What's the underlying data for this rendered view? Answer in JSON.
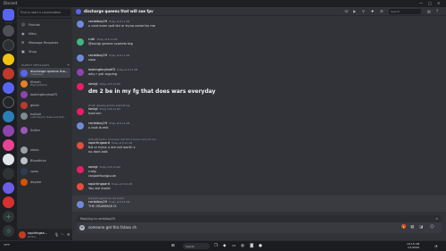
{
  "window": {
    "title": "Discord",
    "controls": [
      "—",
      "□",
      "✕"
    ]
  },
  "colors": {
    "accent": "#5865f2",
    "bg": "#313338",
    "sidebar": "#2b2d31",
    "rail": "#1e1f22"
  },
  "sidebar": {
    "search_placeholder": "Find or start a conversation",
    "nav": [
      {
        "icon": "friends-icon",
        "glyph": "☺",
        "label": "Friends"
      },
      {
        "icon": "nitro-icon",
        "glyph": "◉",
        "label": "Nitro"
      },
      {
        "icon": "message-requests-icon",
        "glyph": "✉",
        "label": "Message Requests"
      },
      {
        "icon": "shop-icon",
        "glyph": "▣",
        "label": "Shop"
      }
    ],
    "dm_header": "DIRECT MESSAGES",
    "dm_add": "+",
    "dms": [
      {
        "name": "discharge queens tha...",
        "sub": "5 Members",
        "color": "#5865f2",
        "active": true
      },
      {
        "name": "Ktrash",
        "sub": "Playing Roblox",
        "color": "#e67e22"
      },
      {
        "name": "lookingforyksdf3",
        "sub": "",
        "color": "#8e44ad"
      },
      {
        "name": "glotzi",
        "sub": "",
        "color": "#c0392b"
      },
      {
        "name": "hailroll",
        "sub": "I just have to make sure that...",
        "color": "#7f8c8d"
      },
      {
        "name": "Sullen",
        "sub": "",
        "color": "#9b59b6"
      },
      {
        "name": "vibes",
        "sub": "",
        "color": "#95a5a6"
      },
      {
        "name": "Bloodhive",
        "sub": "",
        "color": "#bdc3c7"
      },
      {
        "name": "cows",
        "sub": "",
        "color": "#2c3e50"
      },
      {
        "name": "deyste",
        "sub": "",
        "color": "#d35400"
      }
    ],
    "user": {
      "name": "squirtingaa...",
      "status": "Online"
    }
  },
  "header": {
    "title": "discharge queens that will sue fpv",
    "search_placeholder": "Search"
  },
  "messages": [
    {
      "author": "racistboy29",
      "time": "Today at 8:13 AM",
      "avatar": "#7289da",
      "lines": [
        "u cant even quit ttd ur tryna come for me"
      ]
    },
    {
      "author": "ruth",
      "time": "Today at 8:13 AM",
      "avatar": "#43b581",
      "lines": [
        "@sevlgi gimme scarlets tag"
      ]
    },
    {
      "author": "racistboy29",
      "time": "Today at 8:13 AM",
      "avatar": "#7289da",
      "lines": [
        "slow"
      ]
    },
    {
      "author": "lookingforyksdf3",
      "time": "Today at 8:13 AM",
      "avatar": "#8e44ad",
      "lines": [
        "why r yall arguing"
      ]
    },
    {
      "author": "sevlgi",
      "time": "Today at 8:14 AM",
      "avatar": "#e91e63",
      "lines": [
        "dm 2 be in my fg that does wars everyday"
      ]
    },
    {
      "author": "sevlgi",
      "time": "Today at 8:14 AM",
      "avatar": "#e91e63",
      "reply": "@ruth @sevlgi gimme scarlets tag",
      "lines": [
        "hold em"
      ]
    },
    {
      "author": "racistboy29",
      "time": "Today at 8:14 AM",
      "avatar": "#7289da",
      "lines": [
        "u look dumb"
      ]
    },
    {
      "author": "squirtingaard",
      "time": "Today at 8:14 AM",
      "avatar": "#e74c3c",
      "reply": "@racistboy29 u cant even quit ttd ur tryna come for me",
      "lines": [
        "ttd ur tryna u are not worth s",
        "no dont talk"
      ]
    },
    {
      "author": "sevlgi",
      "time": "Today at 8:14 AM",
      "avatar": "#e91e63",
      "lines": [
        "rusty",
        "ranjoeifsonjpuuie"
      ]
    },
    {
      "author": "squirtingaard",
      "time": "Today at 8:14 AM",
      "avatar": "#e74c3c",
      "lines": [
        "You are dumb"
      ]
    },
    {
      "author": "racistboy29",
      "time": "Today at 8:15 AM",
      "avatar": "#7289da",
      "reply": "@squirtingaard You are dumb",
      "lines": [
        "THE GRAMMAR IS"
      ]
    }
  ],
  "composer": {
    "replying_to": "Replying to racistboy29",
    "text": "someone get this fatass ch"
  },
  "taskbar": {
    "weather": "79°F",
    "search": "Search",
    "time": "10:15 AM",
    "date": "7/1/2025"
  }
}
